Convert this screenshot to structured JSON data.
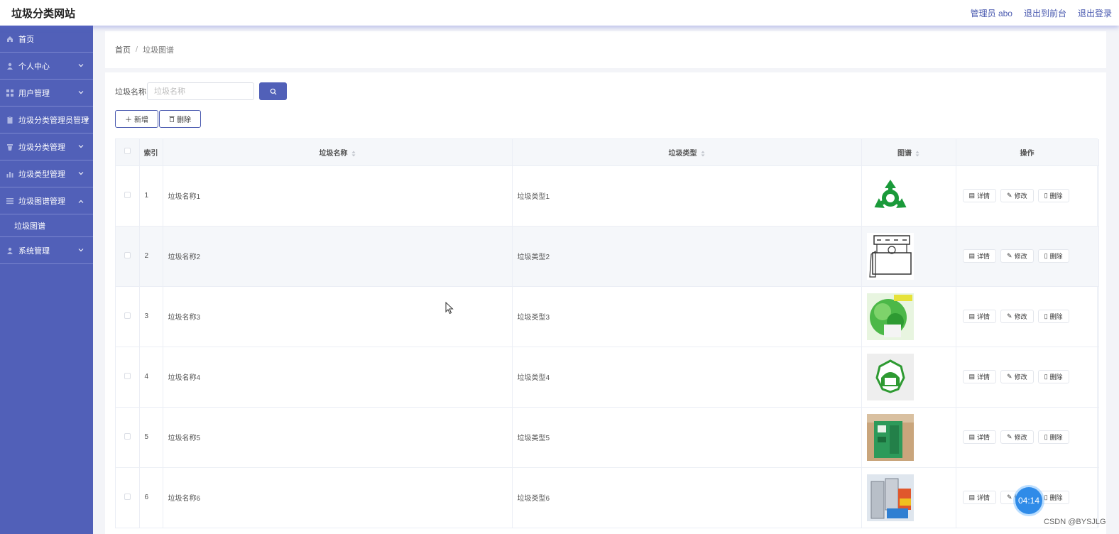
{
  "header": {
    "site_title": "垃圾分类网站",
    "admin_label": "管理员 abo",
    "front_link": "退出到前台",
    "logout_link": "退出登录"
  },
  "sidebar": {
    "items": [
      {
        "label": "首页",
        "icon": "home-icon"
      },
      {
        "label": "个人中心",
        "icon": "user-icon"
      },
      {
        "label": "用户管理",
        "icon": "grid-icon"
      },
      {
        "label": "垃圾分类管理员管理",
        "icon": "clipboard-icon"
      },
      {
        "label": "垃圾分类管理",
        "icon": "trash-icon"
      },
      {
        "label": "垃圾类型管理",
        "icon": "chart-icon"
      },
      {
        "label": "垃圾图谱管理",
        "icon": "list-icon"
      },
      {
        "label": "系统管理",
        "icon": "user-icon"
      }
    ],
    "sub_item": "垃圾图谱"
  },
  "breadcrumb": {
    "home": "首页",
    "sep": "/",
    "current": "垃圾图谱"
  },
  "search": {
    "label": "垃圾名称",
    "placeholder": "垃圾名称"
  },
  "actions": {
    "add": "新增",
    "delete": "删除"
  },
  "table": {
    "headers": {
      "index": "索引",
      "name": "垃圾名称",
      "type": "垃圾类型",
      "image": "图谱",
      "ops": "操作"
    },
    "op_labels": {
      "detail": "详情",
      "edit": "修改",
      "delete": "删除"
    },
    "rows": [
      {
        "index": "1",
        "name": "垃圾名称1",
        "type": "垃圾类型1"
      },
      {
        "index": "2",
        "name": "垃圾名称2",
        "type": "垃圾类型2"
      },
      {
        "index": "3",
        "name": "垃圾名称3",
        "type": "垃圾类型3"
      },
      {
        "index": "4",
        "name": "垃圾名称4",
        "type": "垃圾类型4"
      },
      {
        "index": "5",
        "name": "垃圾名称5",
        "type": "垃圾类型5"
      },
      {
        "index": "6",
        "name": "垃圾名称6",
        "type": "垃圾类型6"
      }
    ]
  },
  "overlay": {
    "timer": "04:14",
    "watermark": "CSDN @BYSJLG"
  },
  "colors": {
    "accent": "#5160b8",
    "sidebar_bg": "#5160b8",
    "timer": "#2f8be8"
  }
}
